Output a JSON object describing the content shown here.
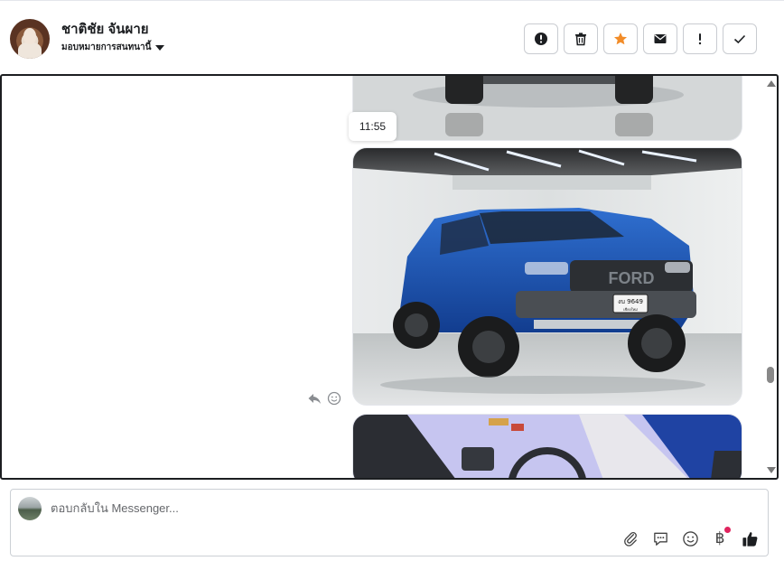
{
  "header": {
    "contact_name": "ชาติชัย จันผาย",
    "assign_label": "มอบหมายการสนทนานี้",
    "actions": [
      {
        "name": "report-spam",
        "icon": "exclamation-circle-icon"
      },
      {
        "name": "delete",
        "icon": "trash-icon"
      },
      {
        "name": "star",
        "icon": "star-icon",
        "color": "#f28c28"
      },
      {
        "name": "mark-unread",
        "icon": "envelope-icon"
      },
      {
        "name": "mark-important",
        "icon": "exclamation-icon"
      },
      {
        "name": "mark-done",
        "icon": "check-icon"
      }
    ]
  },
  "thread": {
    "timestamp": "11:55",
    "plate_text": "งบ 9649",
    "plate_province": "เชียงใหม่",
    "grille_text": "FORD",
    "message_tools": [
      "reply-icon",
      "emoji-reaction-icon"
    ]
  },
  "composer": {
    "placeholder": "ตอบกลับใน Messenger...",
    "tools": [
      "paperclip-icon",
      "saved-replies-icon",
      "emoji-icon",
      "baht-icon",
      "thumbs-up-icon"
    ],
    "baht_symbol": "฿"
  },
  "colors": {
    "accent_star": "#f28c28",
    "border_dark": "#1c1e21",
    "notification_dot": "#e0245e"
  }
}
